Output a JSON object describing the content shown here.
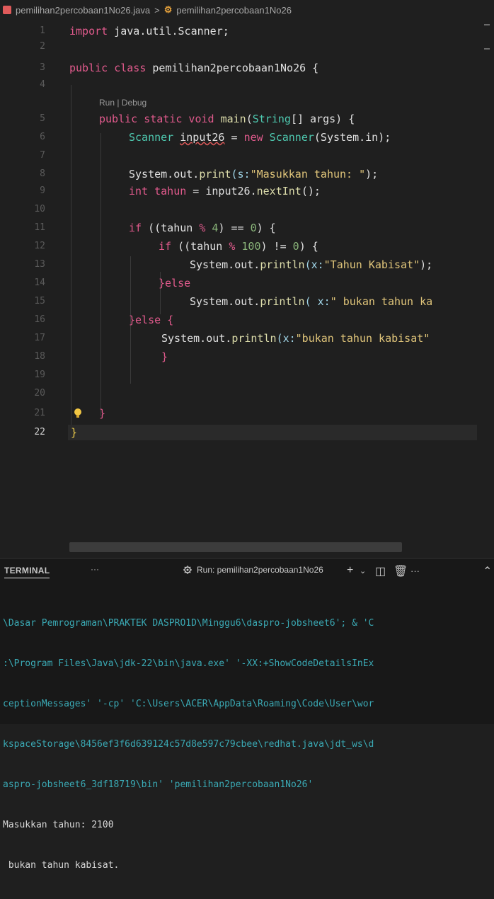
{
  "breadcrumb": {
    "file": "pemilihan2percobaan1No26.java",
    "separator": ">",
    "symbol": "pemilihan2percobaan1No26"
  },
  "editor": {
    "line_numbers": [
      "1",
      "2",
      "3",
      "4",
      "5",
      "6",
      "7",
      "8",
      "9",
      "10",
      "11",
      "12",
      "13",
      "14",
      "15",
      "16",
      "17",
      "18",
      "19",
      "20",
      "21",
      "22"
    ],
    "codelens": "Run | Debug",
    "code": {
      "l1_import": "import",
      "l1_rest": " java.util.Scanner;",
      "l3_public": "public",
      "l3_class": " class ",
      "l3_name": "pemilihan2percobaan1No26",
      "l3_brace": " {",
      "l5_public": "public",
      "l5_static": " static",
      "l5_void": " void ",
      "l5_main": "main",
      "l5_paren": "(",
      "l5_string": "String",
      "l5_rest": "[] args) {",
      "l6_scanner": "Scanner ",
      "l6_var": "input26",
      "l6_eq": " = ",
      "l6_new": "new",
      "l6_scanner2": " Scanner",
      "l6_rest": "(System.in);",
      "l8_sys": "System.out.",
      "l8_print": "print",
      "l8_hint": "(s:",
      "l8_str": "\"Masukkan tahun: \"",
      "l8_end": ");",
      "l9_int": "int",
      "l9_tahun": " tahun",
      "l9_eq": " = ",
      "l9_input": "input26.",
      "l9_next": "nextInt",
      "l9_end": "();",
      "l11_if": "if",
      "l11_a": " ((",
      "l11_tahun": "tahun",
      "l11_b": " % ",
      "l11_4": "4",
      "l11_c": ") == ",
      "l11_0": "0",
      "l11_d": ") {",
      "l12_if": "if",
      "l12_a": " ((",
      "l12_tahun": "tahun",
      "l12_b": " % ",
      "l12_100": "100",
      "l12_c": ") != ",
      "l12_0": "0",
      "l12_d": ") {",
      "l13_sys": "System.out.",
      "l13_println": "println",
      "l13_hint": "(x:",
      "l13_str": "\"Tahun Kabisat\"",
      "l13_end": ");",
      "l14_else": "}else",
      "l15_sys": "System.out.",
      "l15_println": "println",
      "l15_hint": "( x:",
      "l15_str": "\" bukan tahun ka",
      "l16_else": "}else {",
      "l17_sys": "System.out.",
      "l17_println": "println",
      "l17_hint": "(x:",
      "l17_str": "\"bukan tahun kabisat\"",
      "l18_brace": "}",
      "l21_brace": "}",
      "l22_brace": "}"
    }
  },
  "terminal": {
    "tab_label": "TERMINAL",
    "more": "···",
    "run_label": "Run: pemilihan2percobaan1No26",
    "lines": [
      "\\Dasar Pemrograman\\PRAKTEK DASPRO1D\\Minggu6\\daspro-jobsheet6'; & 'C",
      ":\\Program Files\\Java\\jdk-22\\bin\\java.exe' '-XX:+ShowCodeDetailsInEx",
      "ceptionMessages' '-cp' 'C:\\Users\\ACER\\AppData\\Roaming\\Code\\User\\wor",
      "kspaceStorage\\8456ef3f6d639124c57d8e597c79cbee\\redhat.java\\jdt_ws\\d",
      "aspro-jobsheet6_3df18719\\bin' 'pemilihan2percobaan1No26'"
    ],
    "output": [
      "Masukkan tahun: 2100",
      " bukan tahun kabisat."
    ]
  }
}
